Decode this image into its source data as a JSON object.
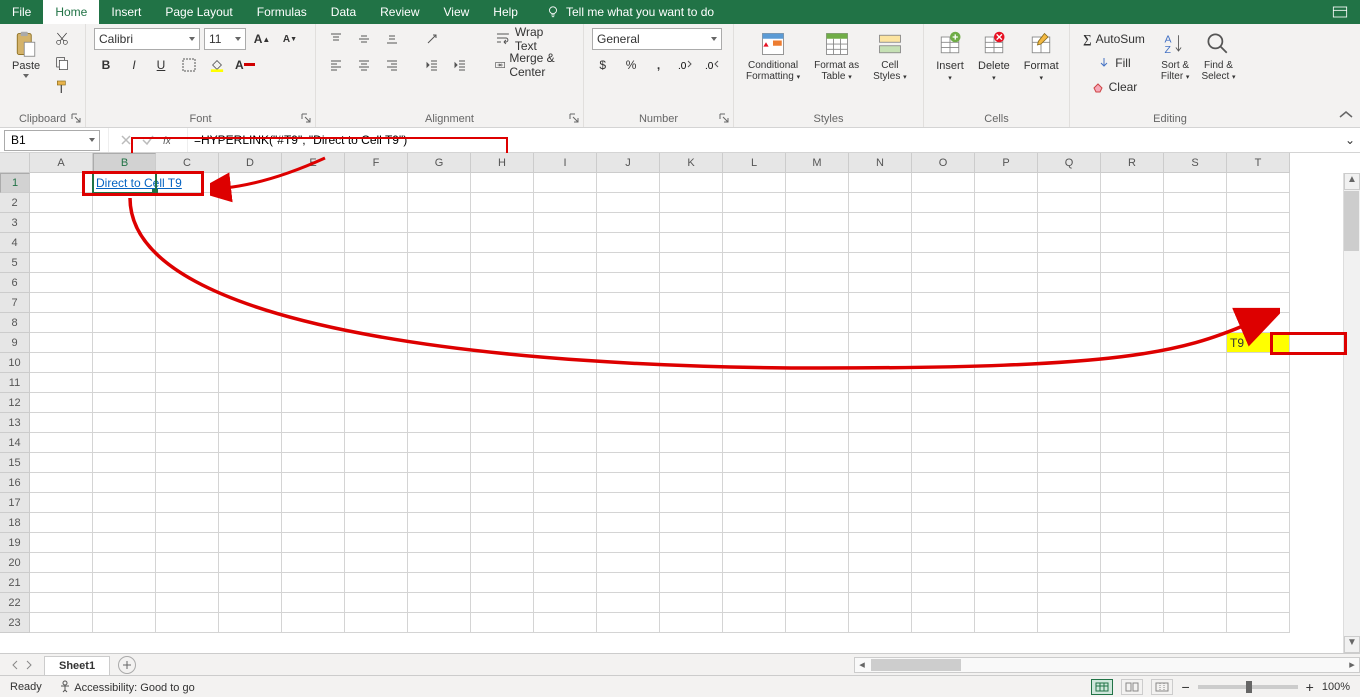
{
  "tabs": {
    "file": "File",
    "home": "Home",
    "insert": "Insert",
    "page_layout": "Page Layout",
    "formulas": "Formulas",
    "data": "Data",
    "review": "Review",
    "view": "View",
    "help": "Help"
  },
  "tell_me": "Tell me what you want to do",
  "ribbon": {
    "clipboard": {
      "label": "Clipboard",
      "paste": "Paste"
    },
    "font": {
      "label": "Font",
      "name": "Calibri",
      "size": "11",
      "bold": "B",
      "italic": "I",
      "underline": "U"
    },
    "alignment": {
      "label": "Alignment",
      "wrap": "Wrap Text",
      "merge": "Merge & Center"
    },
    "number": {
      "label": "Number",
      "format": "General"
    },
    "styles": {
      "label": "Styles",
      "cond": "Conditional Formatting",
      "table": "Format as Table",
      "cell": "Cell Styles"
    },
    "cells": {
      "label": "Cells",
      "insert": "Insert",
      "delete": "Delete",
      "format": "Format"
    },
    "editing": {
      "label": "Editing",
      "autosum": "AutoSum",
      "fill": "Fill",
      "clear": "Clear",
      "sort": "Sort & Filter",
      "find": "Find & Select"
    }
  },
  "namebox": "B1",
  "formula": "=HYPERLINK(\"#T9\", \"Direct to Cell T9\")",
  "cell_b1": "Direct to Cell T9",
  "cell_t9": "T9",
  "columns": [
    "A",
    "B",
    "C",
    "D",
    "E",
    "F",
    "G",
    "H",
    "I",
    "J",
    "K",
    "L",
    "M",
    "N",
    "O",
    "P",
    "Q",
    "R",
    "S",
    "T"
  ],
  "rows": 23,
  "sheet": {
    "name": "Sheet1"
  },
  "status": {
    "ready": "Ready",
    "accessibility": "Accessibility: Good to go",
    "zoom": "100%"
  }
}
